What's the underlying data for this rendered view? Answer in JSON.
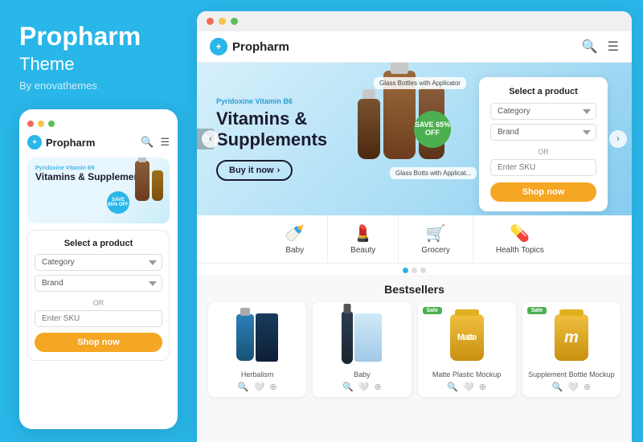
{
  "left": {
    "title": "Propharm",
    "subtitle": "Theme",
    "by": "By enovathemes",
    "mobile": {
      "logo": "Propharm",
      "hero_label": "Pyridoxine Vitamin B6",
      "hero_title": "Vitamins & Supplements",
      "badge": "SAVE 65% OFF",
      "select_product_title": "Select a product",
      "category_placeholder": "Category",
      "brand_placeholder": "Brand",
      "or_label": "OR",
      "sku_placeholder": "Enter SKU",
      "shop_now": "Shop now"
    }
  },
  "right": {
    "browser_dots": [
      "red",
      "yellow",
      "green"
    ],
    "site": {
      "logo": "Propharm",
      "hero_label": "Pyridoxine Vitamin B6",
      "hero_title_line1": "Vitamins &",
      "hero_title_line2": "Supplements",
      "hero_btn": "Buy it now",
      "badge_text": "SAVE 65% OFF",
      "label_tag1": "Glass Bottles with Applicator",
      "label_tag2": "Glass Botts with Applicat...",
      "select_product": {
        "title": "Select a product",
        "category_placeholder": "Category",
        "brand_placeholder": "Brand",
        "or_label": "OR",
        "sku_placeholder": "Enter SKU",
        "shop_now": "Shop now"
      },
      "categories": [
        {
          "icon": "🍼",
          "label": "Baby"
        },
        {
          "icon": "💄",
          "label": "Beauty"
        },
        {
          "icon": "🛒",
          "label": "Grocery"
        },
        {
          "icon": "💊",
          "label": "Health Topics"
        }
      ],
      "bestsellers_title": "Bestsellers",
      "products": [
        {
          "label": "Herbalism",
          "sale": false
        },
        {
          "label": "Baby",
          "sale": false
        },
        {
          "label": "Matte Plastic Mockup",
          "sale": true
        },
        {
          "label": "Supplement Bottle Mockup",
          "sale": true
        }
      ]
    }
  }
}
